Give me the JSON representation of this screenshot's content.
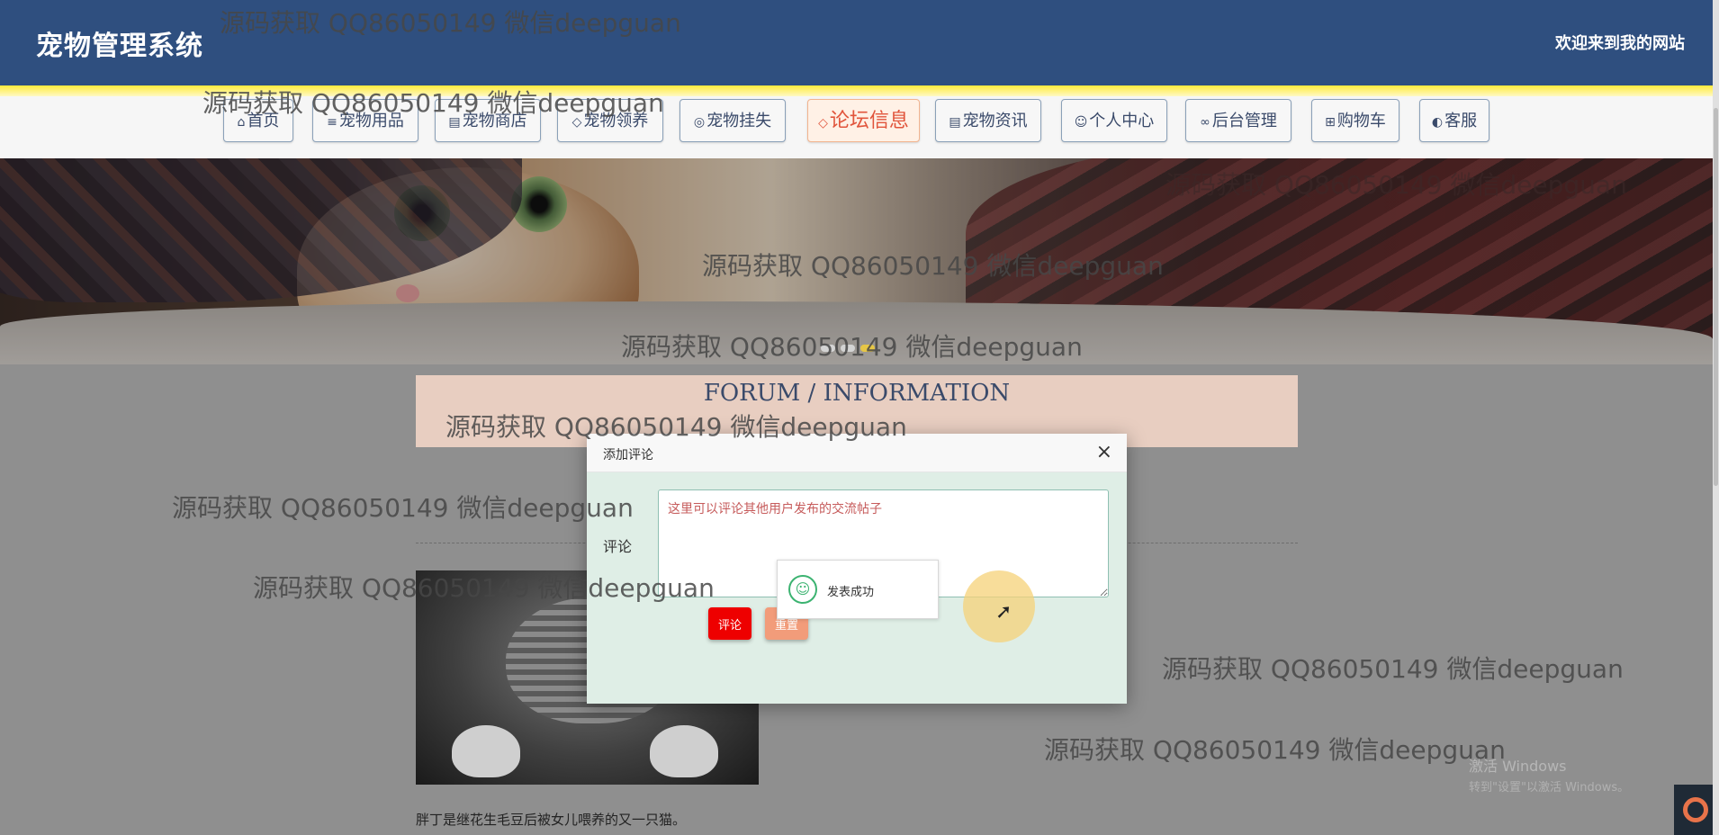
{
  "header": {
    "title": "宠物管理系统",
    "welcome": "欢迎来到我的网站"
  },
  "nav": [
    {
      "icon": "⌂",
      "label": "首页"
    },
    {
      "icon": "≡",
      "label": "宠物用品"
    },
    {
      "icon": "▤",
      "label": "宠物商店"
    },
    {
      "icon": "◇",
      "label": "宠物领养"
    },
    {
      "icon": "◎",
      "label": "宠物挂失"
    },
    {
      "icon": "◇",
      "label": "论坛信息",
      "active": true
    },
    {
      "icon": "▤",
      "label": "宠物资讯"
    },
    {
      "icon": "☺",
      "label": "个人中心"
    },
    {
      "icon": "∞",
      "label": "后台管理"
    },
    {
      "icon": "⊞",
      "label": "购物车"
    },
    {
      "icon": "◐",
      "label": "客服"
    }
  ],
  "forum": {
    "title": "FORUM / INFORMATION",
    "post_text": "胖丁是继花生毛豆后被女儿喂养的又一只猫。"
  },
  "dialog": {
    "title": "添加评论",
    "close": "×",
    "field_label": "评论",
    "placeholder": "这里可以评论其他用户发布的交流帖子",
    "submit_label": "评论",
    "reset_label": "重置"
  },
  "toast": {
    "text": "发表成功"
  },
  "watermark": "源码获取 QQ86050149 微信deepguan",
  "os": {
    "activation_line1": "激活 Windows",
    "activation_line2": "转到\"设置\"以激活 Windows。"
  },
  "colors": {
    "header_bg": "#2f4f7f",
    "active_tab": "#e1553c",
    "submit": "#ee0000",
    "reset": "#f29c7a",
    "success": "#3cb371"
  }
}
